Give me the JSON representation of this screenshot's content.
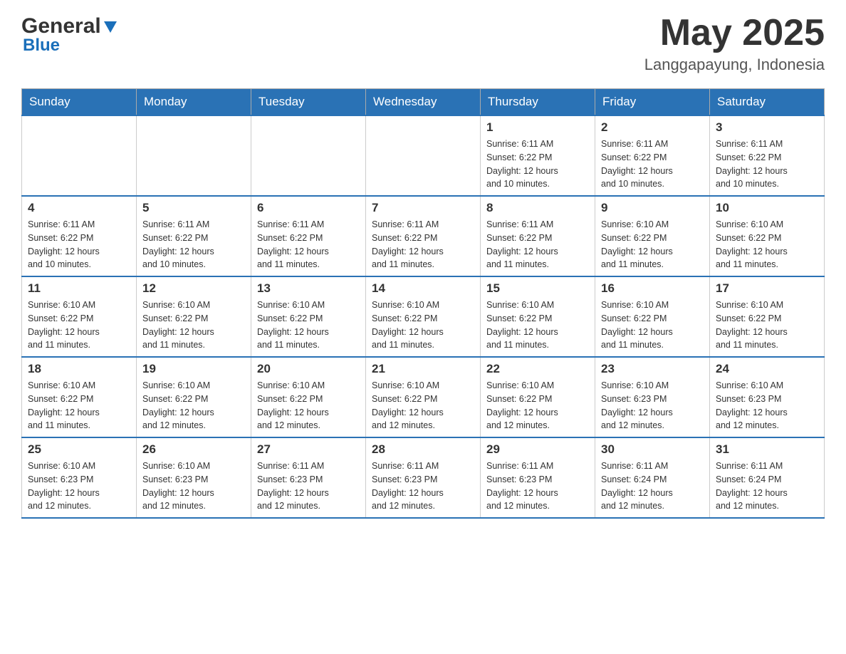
{
  "header": {
    "logo_general": "General",
    "logo_blue": "Blue",
    "month_title": "May 2025",
    "location": "Langgapayung, Indonesia"
  },
  "days_of_week": [
    "Sunday",
    "Monday",
    "Tuesday",
    "Wednesday",
    "Thursday",
    "Friday",
    "Saturday"
  ],
  "weeks": [
    [
      {
        "day": "",
        "info": ""
      },
      {
        "day": "",
        "info": ""
      },
      {
        "day": "",
        "info": ""
      },
      {
        "day": "",
        "info": ""
      },
      {
        "day": "1",
        "info": "Sunrise: 6:11 AM\nSunset: 6:22 PM\nDaylight: 12 hours\nand 10 minutes."
      },
      {
        "day": "2",
        "info": "Sunrise: 6:11 AM\nSunset: 6:22 PM\nDaylight: 12 hours\nand 10 minutes."
      },
      {
        "day": "3",
        "info": "Sunrise: 6:11 AM\nSunset: 6:22 PM\nDaylight: 12 hours\nand 10 minutes."
      }
    ],
    [
      {
        "day": "4",
        "info": "Sunrise: 6:11 AM\nSunset: 6:22 PM\nDaylight: 12 hours\nand 10 minutes."
      },
      {
        "day": "5",
        "info": "Sunrise: 6:11 AM\nSunset: 6:22 PM\nDaylight: 12 hours\nand 10 minutes."
      },
      {
        "day": "6",
        "info": "Sunrise: 6:11 AM\nSunset: 6:22 PM\nDaylight: 12 hours\nand 11 minutes."
      },
      {
        "day": "7",
        "info": "Sunrise: 6:11 AM\nSunset: 6:22 PM\nDaylight: 12 hours\nand 11 minutes."
      },
      {
        "day": "8",
        "info": "Sunrise: 6:11 AM\nSunset: 6:22 PM\nDaylight: 12 hours\nand 11 minutes."
      },
      {
        "day": "9",
        "info": "Sunrise: 6:10 AM\nSunset: 6:22 PM\nDaylight: 12 hours\nand 11 minutes."
      },
      {
        "day": "10",
        "info": "Sunrise: 6:10 AM\nSunset: 6:22 PM\nDaylight: 12 hours\nand 11 minutes."
      }
    ],
    [
      {
        "day": "11",
        "info": "Sunrise: 6:10 AM\nSunset: 6:22 PM\nDaylight: 12 hours\nand 11 minutes."
      },
      {
        "day": "12",
        "info": "Sunrise: 6:10 AM\nSunset: 6:22 PM\nDaylight: 12 hours\nand 11 minutes."
      },
      {
        "day": "13",
        "info": "Sunrise: 6:10 AM\nSunset: 6:22 PM\nDaylight: 12 hours\nand 11 minutes."
      },
      {
        "day": "14",
        "info": "Sunrise: 6:10 AM\nSunset: 6:22 PM\nDaylight: 12 hours\nand 11 minutes."
      },
      {
        "day": "15",
        "info": "Sunrise: 6:10 AM\nSunset: 6:22 PM\nDaylight: 12 hours\nand 11 minutes."
      },
      {
        "day": "16",
        "info": "Sunrise: 6:10 AM\nSunset: 6:22 PM\nDaylight: 12 hours\nand 11 minutes."
      },
      {
        "day": "17",
        "info": "Sunrise: 6:10 AM\nSunset: 6:22 PM\nDaylight: 12 hours\nand 11 minutes."
      }
    ],
    [
      {
        "day": "18",
        "info": "Sunrise: 6:10 AM\nSunset: 6:22 PM\nDaylight: 12 hours\nand 11 minutes."
      },
      {
        "day": "19",
        "info": "Sunrise: 6:10 AM\nSunset: 6:22 PM\nDaylight: 12 hours\nand 12 minutes."
      },
      {
        "day": "20",
        "info": "Sunrise: 6:10 AM\nSunset: 6:22 PM\nDaylight: 12 hours\nand 12 minutes."
      },
      {
        "day": "21",
        "info": "Sunrise: 6:10 AM\nSunset: 6:22 PM\nDaylight: 12 hours\nand 12 minutes."
      },
      {
        "day": "22",
        "info": "Sunrise: 6:10 AM\nSunset: 6:22 PM\nDaylight: 12 hours\nand 12 minutes."
      },
      {
        "day": "23",
        "info": "Sunrise: 6:10 AM\nSunset: 6:23 PM\nDaylight: 12 hours\nand 12 minutes."
      },
      {
        "day": "24",
        "info": "Sunrise: 6:10 AM\nSunset: 6:23 PM\nDaylight: 12 hours\nand 12 minutes."
      }
    ],
    [
      {
        "day": "25",
        "info": "Sunrise: 6:10 AM\nSunset: 6:23 PM\nDaylight: 12 hours\nand 12 minutes."
      },
      {
        "day": "26",
        "info": "Sunrise: 6:10 AM\nSunset: 6:23 PM\nDaylight: 12 hours\nand 12 minutes."
      },
      {
        "day": "27",
        "info": "Sunrise: 6:11 AM\nSunset: 6:23 PM\nDaylight: 12 hours\nand 12 minutes."
      },
      {
        "day": "28",
        "info": "Sunrise: 6:11 AM\nSunset: 6:23 PM\nDaylight: 12 hours\nand 12 minutes."
      },
      {
        "day": "29",
        "info": "Sunrise: 6:11 AM\nSunset: 6:23 PM\nDaylight: 12 hours\nand 12 minutes."
      },
      {
        "day": "30",
        "info": "Sunrise: 6:11 AM\nSunset: 6:24 PM\nDaylight: 12 hours\nand 12 minutes."
      },
      {
        "day": "31",
        "info": "Sunrise: 6:11 AM\nSunset: 6:24 PM\nDaylight: 12 hours\nand 12 minutes."
      }
    ]
  ]
}
